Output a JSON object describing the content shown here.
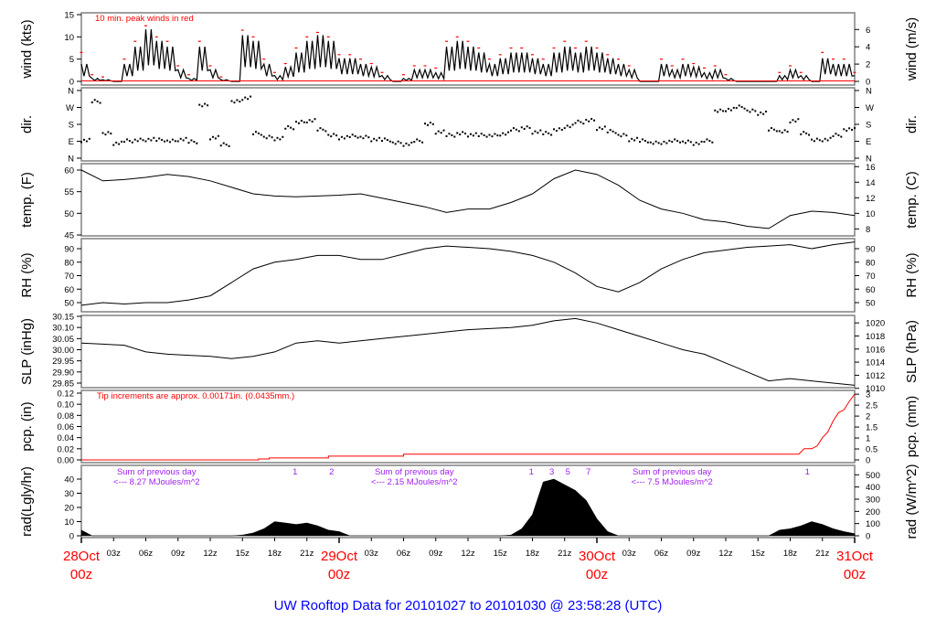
{
  "title": "UW Rooftop Data for 20101027  to  20101030 @ 23:58:28  (UTC)",
  "colors": {
    "series": "#000000",
    "peak": "#ff0000",
    "pcp": "#ff0000",
    "day_label": "#ff0000",
    "annotation_rad": "#a020f0",
    "title": "#0000ff",
    "frame": "#808080"
  },
  "chart_data": {
    "type": "line",
    "title": "UW Rooftop Data for 20101027  to  20101030 @ 23:58:28  (UTC)",
    "x": {
      "unit": "hours since 28Oct 00z",
      "range": [
        0,
        72
      ],
      "day_ticks": [
        {
          "hour": 0,
          "date": "28Oct",
          "time": "00z"
        },
        {
          "hour": 24,
          "date": "29Oct",
          "time": "00z"
        },
        {
          "hour": 48,
          "date": "30Oct",
          "time": "00z"
        },
        {
          "hour": 72,
          "date": "31Oct",
          "time": "00z"
        }
      ],
      "hour_ticks": [
        {
          "hour": 3,
          "label": "03z"
        },
        {
          "hour": 6,
          "label": "06z"
        },
        {
          "hour": 9,
          "label": "09z"
        },
        {
          "hour": 12,
          "label": "12z"
        },
        {
          "hour": 15,
          "label": "15z"
        },
        {
          "hour": 18,
          "label": "18z"
        },
        {
          "hour": 21,
          "label": "21z"
        },
        {
          "hour": 27,
          "label": "03z"
        },
        {
          "hour": 30,
          "label": "06z"
        },
        {
          "hour": 33,
          "label": "09z"
        },
        {
          "hour": 36,
          "label": "12z"
        },
        {
          "hour": 39,
          "label": "15z"
        },
        {
          "hour": 42,
          "label": "18z"
        },
        {
          "hour": 45,
          "label": "21z"
        },
        {
          "hour": 51,
          "label": "03z"
        },
        {
          "hour": 54,
          "label": "06z"
        },
        {
          "hour": 57,
          "label": "09z"
        },
        {
          "hour": 60,
          "label": "12z"
        },
        {
          "hour": 63,
          "label": "15z"
        },
        {
          "hour": 66,
          "label": "18z"
        },
        {
          "hour": 69,
          "label": "21z"
        }
      ]
    },
    "panels": [
      {
        "id": "wind",
        "kind": "bar-line",
        "left_label": "wind (kts)",
        "right_label": "wind (m/s)",
        "left_range": [
          0,
          15
        ],
        "right_range": [
          0,
          7.72
        ],
        "left_ticks": [
          0,
          5,
          10,
          15
        ],
        "right_ticks": [
          0,
          2,
          4,
          6
        ],
        "annotation": "10 min. peak winds in red",
        "values": [
          3,
          0.5,
          0.3,
          0,
          3,
          6,
          9,
          7,
          6,
          2,
          0.5,
          6,
          2,
          0.3,
          0,
          8,
          7,
          3,
          1,
          2.5,
          5,
          7,
          8,
          7,
          4,
          4,
          3,
          2.5,
          1,
          0,
          0.5,
          2,
          2,
          1.5,
          6,
          7,
          6,
          5,
          3,
          4,
          5,
          5,
          4,
          3,
          5,
          6,
          5,
          6,
          5,
          4,
          3,
          2,
          0,
          0,
          3,
          2,
          3,
          2.5,
          1.5,
          2,
          0.5,
          0,
          0,
          0,
          0,
          1,
          2,
          1,
          0,
          4,
          3,
          3,
          1
        ],
        "peaks": [
          6.5,
          1.5,
          1,
          0,
          5,
          9,
          12.5,
          10,
          9,
          3.5,
          1.5,
          9,
          3.5,
          1,
          0,
          11.5,
          10,
          5,
          2,
          4,
          7.5,
          10,
          11,
          10,
          6,
          6,
          5,
          4,
          2,
          0,
          1.5,
          3.5,
          3.5,
          3,
          9,
          10,
          9,
          7.5,
          5,
          6,
          7.5,
          7.5,
          6,
          5,
          7.5,
          9,
          7.5,
          9,
          7.5,
          6,
          5,
          3.5,
          0,
          0,
          5,
          3.5,
          5,
          4,
          3,
          3.5,
          1.5,
          0,
          0,
          0,
          0,
          2,
          3.5,
          2,
          0,
          6.5,
          5,
          5,
          2
        ]
      },
      {
        "id": "dir",
        "kind": "scatter",
        "left_label": "dir.",
        "right_label": "dir.",
        "left_range": [
          0,
          360
        ],
        "right_range": [
          0,
          360
        ],
        "left_ticks": [
          {
            "v": 0,
            "l": "N"
          },
          {
            "v": 90,
            "l": "E"
          },
          {
            "v": 180,
            "l": "S"
          },
          {
            "v": 270,
            "l": "W"
          },
          {
            "v": 360,
            "l": "N"
          }
        ],
        "right_ticks": [
          {
            "v": 0,
            "l": "N"
          },
          {
            "v": 90,
            "l": "E"
          },
          {
            "v": 180,
            "l": "S"
          },
          {
            "v": 270,
            "l": "W"
          },
          {
            "v": 360,
            "l": "N"
          }
        ],
        "values": [
          95,
          300,
          130,
          80,
          90,
          95,
          100,
          95,
          90,
          100,
          85,
          280,
          110,
          70,
          300,
          320,
          130,
          110,
          105,
          160,
          190,
          200,
          150,
          120,
          110,
          115,
          110,
          100,
          95,
          80,
          75,
          90,
          180,
          140,
          120,
          130,
          125,
          120,
          120,
          130,
          150,
          160,
          140,
          130,
          150,
          170,
          190,
          200,
          160,
          140,
          120,
          100,
          90,
          80,
          85,
          90,
          85,
          80,
          90,
          250,
          260,
          270,
          250,
          240,
          150,
          140,
          200,
          130,
          95,
          100,
          120,
          150,
          170
        ]
      },
      {
        "id": "temp",
        "kind": "line",
        "left_label": "temp. (F)",
        "right_label": "temp. (C)",
        "left_range": [
          45,
          60
        ],
        "right_range": [
          7.22,
          15.56
        ],
        "left_ticks": [
          45,
          50,
          55,
          60
        ],
        "right_ticks": [
          8,
          10,
          12,
          14,
          16
        ],
        "step_hours": 2,
        "values": [
          60,
          57.5,
          57.8,
          58.3,
          59,
          58.5,
          57.5,
          56,
          54.5,
          54,
          53.8,
          54,
          54.2,
          54.5,
          53.5,
          52.5,
          51.5,
          50.2,
          51,
          51,
          52.5,
          54.5,
          58,
          60,
          59,
          56.5,
          53,
          51,
          50,
          48.5,
          48,
          47,
          46.5,
          49.5,
          50.5,
          50.2,
          49.5
        ]
      },
      {
        "id": "rh",
        "kind": "line",
        "left_label": "RH (%)",
        "right_label": "RH (%)",
        "left_range": [
          50,
          90
        ],
        "right_range": [
          50,
          90
        ],
        "left_ticks": [
          50,
          60,
          70,
          80,
          90
        ],
        "right_ticks": [
          50,
          60,
          70,
          80,
          90
        ],
        "step_hours": 2,
        "values": [
          48,
          50,
          49,
          50,
          50,
          52,
          55,
          65,
          75,
          80,
          82,
          85,
          85,
          82,
          82,
          86,
          90,
          92,
          91,
          90,
          88,
          85,
          80,
          72,
          62,
          58,
          65,
          75,
          82,
          87,
          89,
          91,
          92,
          93,
          90,
          93,
          95
        ]
      },
      {
        "id": "slp",
        "kind": "line",
        "left_label": "SLP (inHg)",
        "right_label": "SLP (hPa)",
        "left_range": [
          29.85,
          30.15
        ],
        "right_range": [
          1010.8,
          1021.0
        ],
        "left_ticks": [
          "29.85",
          "29.90",
          "29.95",
          "30.00",
          "30.05",
          "30.10",
          "30.15"
        ],
        "right_ticks": [
          1010,
          1012,
          1014,
          1016,
          1018,
          1020
        ],
        "step_hours": 2,
        "values": [
          30.03,
          30.025,
          30.02,
          29.99,
          29.98,
          29.975,
          29.97,
          29.96,
          29.97,
          29.99,
          30.03,
          30.04,
          30.03,
          30.04,
          30.05,
          30.06,
          30.07,
          30.08,
          30.09,
          30.095,
          30.1,
          30.11,
          30.13,
          30.14,
          30.12,
          30.09,
          30.06,
          30.03,
          30.0,
          29.98,
          29.94,
          29.9,
          29.86,
          29.87,
          29.86,
          29.85,
          29.84
        ]
      },
      {
        "id": "pcp",
        "kind": "step",
        "left_label": "pcp. (in)",
        "right_label": "pcp. (mm)",
        "left_range": [
          0,
          0.12
        ],
        "right_range": [
          0,
          3.048
        ],
        "left_ticks": [
          "0.00",
          "0.02",
          "0.04",
          "0.06",
          "0.08",
          "0.10",
          "0.12"
        ],
        "right_ticks": [
          "0",
          "0.5",
          "1",
          "1.5",
          "2",
          "2.5",
          "3"
        ],
        "annotation": "Tip increments are approx. 0.00171in. (0.0435mm.)",
        "points": [
          [
            0,
            0
          ],
          [
            16.5,
            0
          ],
          [
            16.5,
            0.0017
          ],
          [
            17.5,
            0.0017
          ],
          [
            17.5,
            0.0034
          ],
          [
            23,
            0.0034
          ],
          [
            23,
            0.0068
          ],
          [
            30,
            0.0068
          ],
          [
            30,
            0.0103
          ],
          [
            66.8,
            0.0103
          ],
          [
            67.3,
            0.02
          ],
          [
            68,
            0.02
          ],
          [
            68.5,
            0.025
          ],
          [
            69,
            0.04
          ],
          [
            69.5,
            0.05
          ],
          [
            70,
            0.07
          ],
          [
            70.5,
            0.085
          ],
          [
            71,
            0.09
          ],
          [
            71.5,
            0.105
          ],
          [
            72,
            0.118
          ]
        ]
      },
      {
        "id": "rad",
        "kind": "area",
        "left_label": "rad(Lgly/hr)",
        "right_label": "rad (W/m^2)",
        "left_range": [
          0,
          40
        ],
        "right_range": [
          0,
          465
        ],
        "left_ticks": [
          0,
          10,
          20,
          30,
          40
        ],
        "right_ticks": [
          0,
          100,
          200,
          300,
          400,
          500
        ],
        "values": [
          4,
          0,
          0,
          0,
          0,
          0,
          0,
          0,
          0,
          0,
          0,
          0,
          0,
          0,
          0,
          0.5,
          2,
          5,
          10,
          9,
          8,
          9,
          7,
          4,
          3,
          0,
          0,
          0,
          0,
          0,
          0,
          0,
          0,
          0,
          0,
          0,
          0,
          0,
          0,
          0,
          0.5,
          5,
          15,
          38,
          40,
          36,
          32,
          25,
          12,
          3,
          0,
          0,
          0,
          0,
          0,
          0,
          0,
          0,
          0,
          0,
          0,
          0,
          0,
          0,
          0,
          4,
          5,
          7,
          10,
          8,
          5,
          3,
          1.5
        ],
        "daily_sums": [
          {
            "hour": 7,
            "line1": "Sum of previous day",
            "line2": "<--- 8.27 MJoules/m^2"
          },
          {
            "hour": 31,
            "line1": "Sum of previous day",
            "line2": "<--- 2.15 MJoules/m^2"
          },
          {
            "hour": 55,
            "line1": "Sum of previous day",
            "line2": "<--- 7.5 MJoules/m^2"
          }
        ],
        "markers": [
          {
            "hour": 19.9,
            "label": "1"
          },
          {
            "hour": 23.3,
            "label": "2"
          },
          {
            "hour": 41.9,
            "label": "1"
          },
          {
            "hour": 43.8,
            "label": "3"
          },
          {
            "hour": 45.3,
            "label": "5"
          },
          {
            "hour": 47.2,
            "label": "7"
          },
          {
            "hour": 67.6,
            "label": "1"
          }
        ]
      }
    ]
  }
}
